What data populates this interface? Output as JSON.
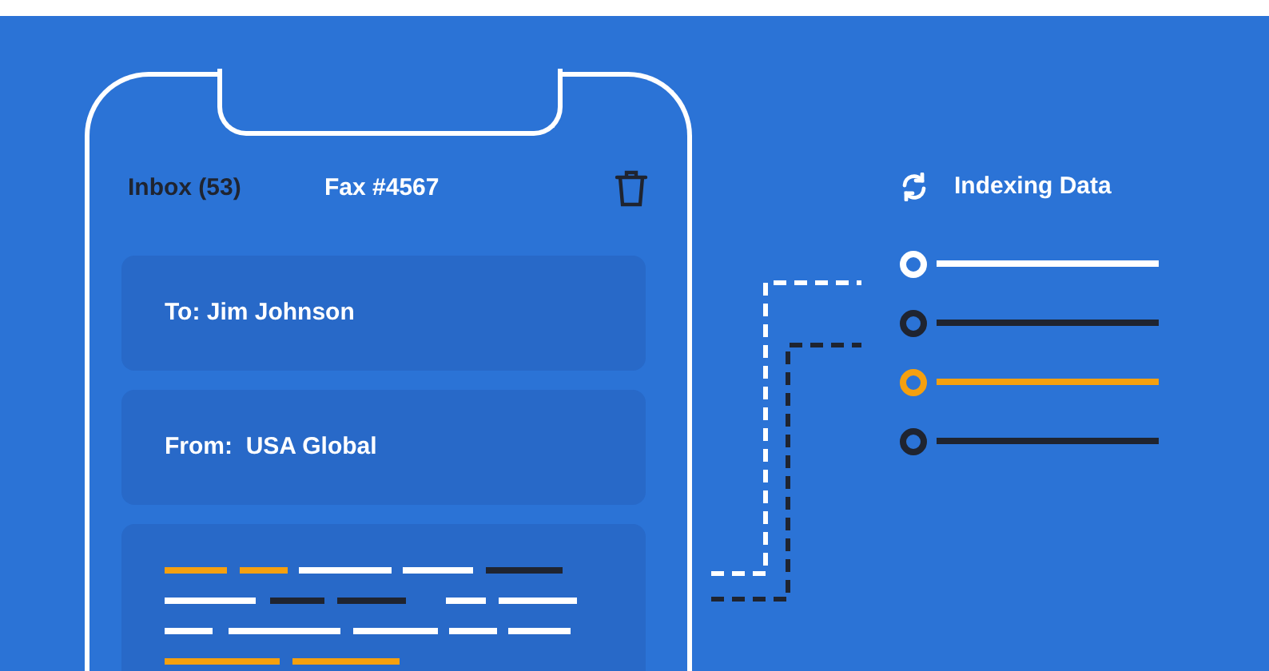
{
  "phone": {
    "header": {
      "inbox": "Inbox (53)",
      "fax": "Fax #4567"
    },
    "fields": [
      {
        "label": "To: Jim Johnson"
      },
      {
        "label": "From:  USA Global"
      }
    ]
  },
  "indexing": {
    "title": "Indexing Data",
    "entries": [
      {
        "color": "#ffffff"
      },
      {
        "color": "#1f2430"
      },
      {
        "color": "#f5a00f"
      },
      {
        "color": "#1f2430"
      }
    ]
  }
}
